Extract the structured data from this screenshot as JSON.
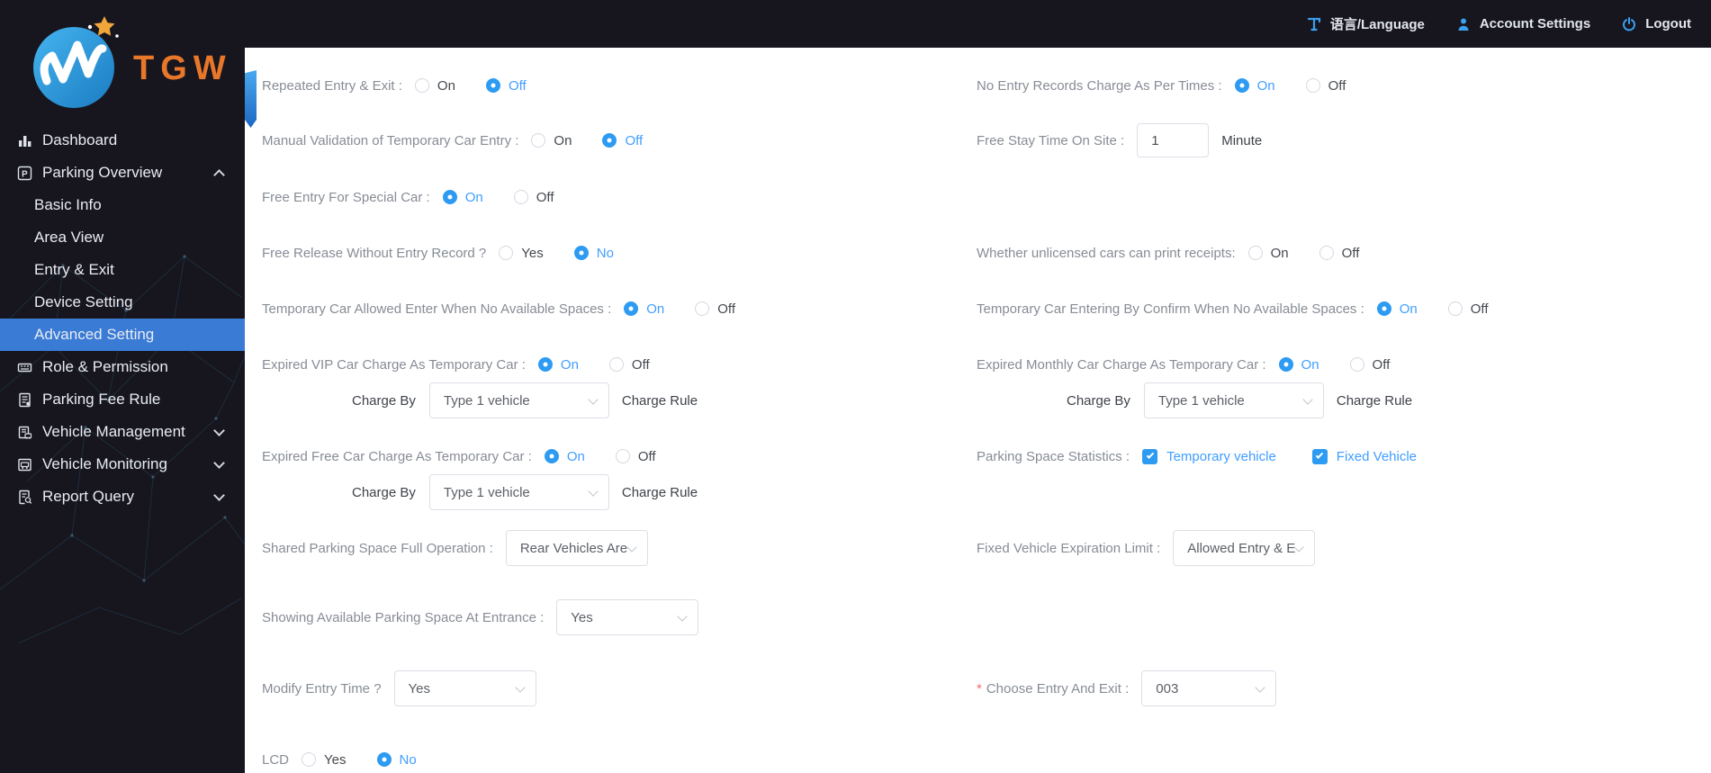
{
  "colors": {
    "accent": "#409EFF",
    "menu_active": "#3a7bd5",
    "brand_orange": "#e9772a",
    "required": "#f56c6c"
  },
  "brand": {
    "name": "TGW"
  },
  "header": {
    "language": "语言/Language",
    "account": "Account Settings",
    "logout": "Logout"
  },
  "sidebar": {
    "dashboard": "Dashboard",
    "parking_overview": "Parking Overview",
    "basic_info": "Basic Info",
    "area_view": "Area View",
    "entry_exit": "Entry & Exit",
    "device_setting": "Device Setting",
    "advanced_setting": "Advanced Setting",
    "role_permission": "Role & Permission",
    "parking_fee_rule": "Parking Fee Rule",
    "vehicle_management": "Vehicle Management",
    "vehicle_monitoring": "Vehicle Monitoring",
    "report_query": "Report Query"
  },
  "form": {
    "repeated_entry": {
      "label": "Repeated Entry & Exit :",
      "on": "On",
      "off": "Off",
      "selected": "Off"
    },
    "no_entry_records": {
      "label": "No Entry Records Charge As Per Times :",
      "on": "On",
      "off": "Off",
      "selected": "On"
    },
    "manual_validation": {
      "label": "Manual Validation of Temporary Car Entry :",
      "on": "On",
      "off": "Off",
      "selected": "Off"
    },
    "free_stay": {
      "label": "Free Stay Time On Site :",
      "value": "1",
      "unit": "Minute"
    },
    "free_entry_special": {
      "label": "Free Entry For Special Car :",
      "on": "On",
      "off": "Off",
      "selected": "On"
    },
    "free_release": {
      "label": "Free Release Without Entry Record ?",
      "yes": "Yes",
      "no": "No",
      "selected": "No"
    },
    "unlicensed_receipts": {
      "label": "Whether unlicensed cars can print receipts:",
      "on": "On",
      "off": "Off",
      "selected": ""
    },
    "temp_allowed": {
      "label": "Temporary Car Allowed Enter When No Available Spaces :",
      "on": "On",
      "off": "Off",
      "selected": "On"
    },
    "temp_confirm": {
      "label": "Temporary Car Entering By Confirm When No Available Spaces :",
      "on": "On",
      "off": "Off",
      "selected": "On"
    },
    "expired_vip": {
      "label": "Expired VIP Car Charge As Temporary Car :",
      "on": "On",
      "off": "Off",
      "selected": "On",
      "charge_by": "Charge By",
      "charge_value": "Type 1 vehicle",
      "charge_rule": "Charge Rule"
    },
    "expired_monthly": {
      "label": "Expired Monthly Car Charge As Temporary Car :",
      "on": "On",
      "off": "Off",
      "selected": "On",
      "charge_by": "Charge By",
      "charge_value": "Type 1 vehicle",
      "charge_rule": "Charge Rule"
    },
    "expired_free": {
      "label": "Expired Free Car Charge As Temporary Car :",
      "on": "On",
      "off": "Off",
      "selected": "On",
      "charge_by": "Charge By",
      "charge_value": "Type 1 vehicle",
      "charge_rule": "Charge Rule"
    },
    "parking_stats": {
      "label": "Parking Space Statistics :",
      "cb1": "Temporary vehicle",
      "cb2": "Fixed Vehicle",
      "cb1_checked": true,
      "cb2_checked": true
    },
    "shared_full": {
      "label": "Shared Parking Space Full Operation :",
      "value": "Rear Vehicles Are"
    },
    "fixed_expiration": {
      "label": "Fixed Vehicle Expiration Limit :",
      "value": "Allowed Entry & E"
    },
    "showing_available": {
      "label": "Showing Available Parking Space At Entrance :",
      "value": "Yes"
    },
    "modify_entry": {
      "label": "Modify Entry Time ?",
      "value": "Yes"
    },
    "choose_entry": {
      "required": "*",
      "label": "Choose Entry And Exit :",
      "value": "003"
    },
    "lcd": {
      "label": "LCD",
      "yes": "Yes",
      "no": "No",
      "selected": "No"
    }
  }
}
